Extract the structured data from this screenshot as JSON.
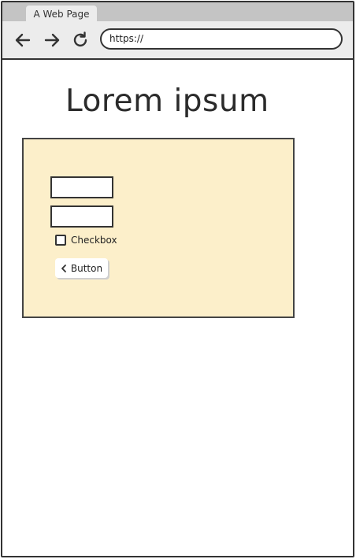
{
  "browser": {
    "tab_title": "A Web Page",
    "url": "https://"
  },
  "page": {
    "heading": "Lorem ipsum"
  },
  "form": {
    "checkbox_label": "Checkbox",
    "checkbox_checked": false,
    "button_label": "Button",
    "button_icon": "chevron-left-icon"
  },
  "colors": {
    "panel_background": "#fcefca"
  }
}
